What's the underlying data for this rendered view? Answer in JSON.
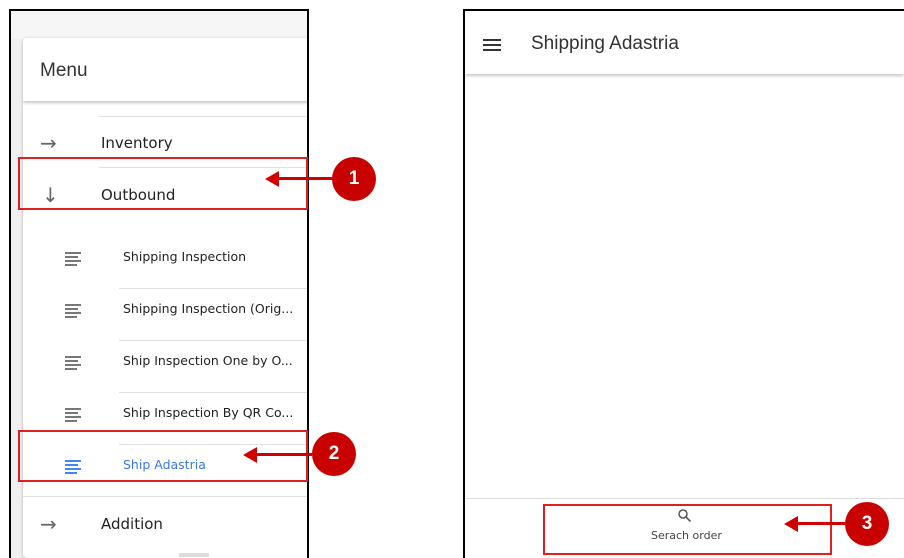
{
  "menu": {
    "title": "Menu",
    "items": [
      {
        "label": "Inventory",
        "icon": "arrow-right-icon"
      },
      {
        "label": "Outbound",
        "icon": "arrow-down-icon"
      },
      {
        "label": "Addition",
        "icon": "arrow-right-icon"
      }
    ],
    "sub_items": [
      {
        "label": "Shipping Inspection",
        "icon": "list-icon"
      },
      {
        "label": "Shipping Inspection (Orig...",
        "icon": "list-icon"
      },
      {
        "label": "Ship Inspection One by O...",
        "icon": "list-icon"
      },
      {
        "label": "Ship Inspection By QR Co...",
        "icon": "list-icon"
      },
      {
        "label": "Ship Adastria",
        "icon": "list-icon",
        "active": true
      }
    ]
  },
  "app": {
    "title": "Shipping Adastria",
    "menu_icon": "hamburger-icon",
    "bottom_nav": {
      "label": "Serach order",
      "icon": "search-icon"
    }
  },
  "callouts": [
    {
      "number": "1"
    },
    {
      "number": "2"
    },
    {
      "number": "3"
    }
  ],
  "colors": {
    "callout_red": "#d00000",
    "active_blue": "#4285f4"
  }
}
